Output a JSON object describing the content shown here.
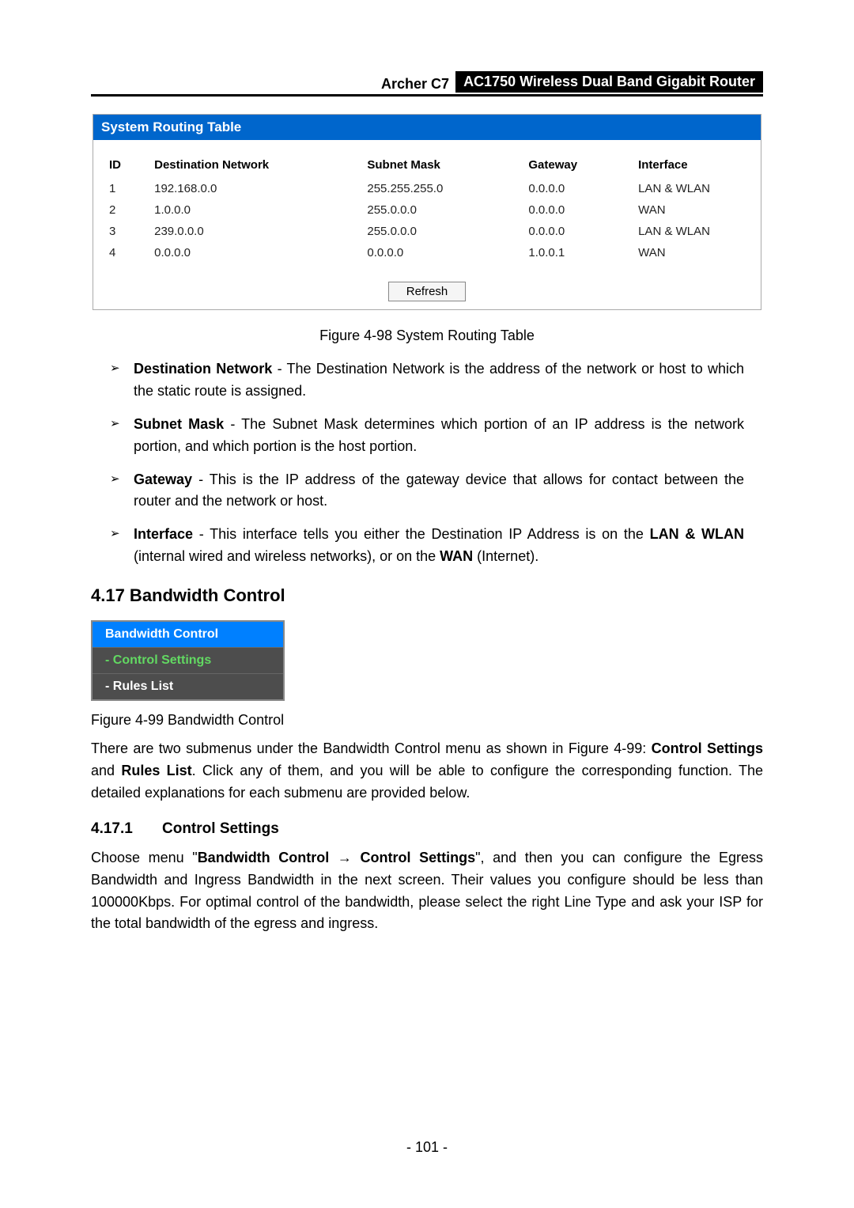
{
  "header": {
    "model": "Archer C7",
    "badge": "AC1750 Wireless Dual Band Gigabit Router"
  },
  "srt": {
    "title": "System Routing Table",
    "headers": [
      "ID",
      "Destination Network",
      "Subnet Mask",
      "Gateway",
      "Interface"
    ],
    "rows": [
      [
        "1",
        "192.168.0.0",
        "255.255.255.0",
        "0.0.0.0",
        "LAN & WLAN"
      ],
      [
        "2",
        "1.0.0.0",
        "255.0.0.0",
        "0.0.0.0",
        "WAN"
      ],
      [
        "3",
        "239.0.0.0",
        "255.0.0.0",
        "0.0.0.0",
        "LAN & WLAN"
      ],
      [
        "4",
        "0.0.0.0",
        "0.0.0.0",
        "1.0.0.1",
        "WAN"
      ]
    ],
    "refresh": "Refresh",
    "caption": "Figure 4-98 System Routing Table"
  },
  "bullets": [
    {
      "term": "Destination Network",
      "rest": " - The Destination Network is the address of the network or host to which the static route is assigned."
    },
    {
      "term": "Subnet Mask",
      "rest": " - The Subnet Mask determines which portion of an IP address is the network portion, and which portion is the host portion."
    },
    {
      "term": "Gateway",
      "rest": " - This is the IP address of the gateway device that allows for contact between the router and the network or host."
    },
    {
      "term": "Interface",
      "rest_pre": " - This interface tells you either the Destination IP Address is on the ",
      "bold1": "LAN & WLAN",
      "rest_mid": " (internal wired and wireless networks), or on the ",
      "bold2": "WAN",
      "rest_end": " (Internet)."
    }
  ],
  "section": {
    "heading": "4.17  Bandwidth Control"
  },
  "nav": {
    "head": "Bandwidth Control",
    "item1": "- Control Settings",
    "item2": "- Rules List"
  },
  "fig2": "Figure 4-99 Bandwidth Control",
  "para1_pre": "There are two submenus under the Bandwidth Control menu as shown in Figure 4-99: ",
  "para1_b1": "Control Settings",
  "para1_mid": " and ",
  "para1_b2": "Rules List",
  "para1_end": ". Click any of them, and you will be able to configure the corresponding function. The detailed explanations for each submenu are provided below.",
  "subsection": {
    "num": "4.17.1",
    "title": "Control Settings"
  },
  "para2_pre": "Choose menu \"",
  "para2_b1": "Bandwidth Control",
  "para2_arrow": " → ",
  "para2_b2": "Control Settings",
  "para2_end": "\", and then you can configure the Egress Bandwidth and Ingress Bandwidth in the next screen. Their values you configure should be less than 100000Kbps. For optimal control of the bandwidth, please select the right Line Type and ask your ISP for the total bandwidth of the egress and ingress.",
  "page_num": "- 101 -"
}
